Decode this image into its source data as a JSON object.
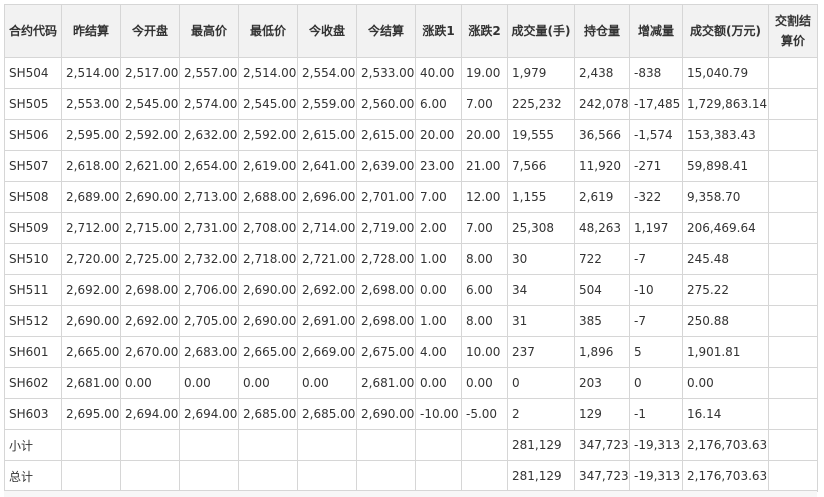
{
  "table": {
    "headers": [
      "合约代码",
      "昨结算",
      "今开盘",
      "最高价",
      "最低价",
      "今收盘",
      "今结算",
      "涨跌1",
      "涨跌2",
      "成交量(手)",
      "持仓量",
      "增减量",
      "成交额(万元)",
      "交割结算价"
    ],
    "rows": [
      [
        "SH504",
        "2,514.00",
        "2,517.00",
        "2,557.00",
        "2,514.00",
        "2,554.00",
        "2,533.00",
        "40.00",
        "19.00",
        "1,979",
        "2,438",
        "-838",
        "15,040.79",
        ""
      ],
      [
        "SH505",
        "2,553.00",
        "2,545.00",
        "2,574.00",
        "2,545.00",
        "2,559.00",
        "2,560.00",
        "6.00",
        "7.00",
        "225,232",
        "242,078",
        "-17,485",
        "1,729,863.14",
        ""
      ],
      [
        "SH506",
        "2,595.00",
        "2,592.00",
        "2,632.00",
        "2,592.00",
        "2,615.00",
        "2,615.00",
        "20.00",
        "20.00",
        "19,555",
        "36,566",
        "-1,574",
        "153,383.43",
        ""
      ],
      [
        "SH507",
        "2,618.00",
        "2,621.00",
        "2,654.00",
        "2,619.00",
        "2,641.00",
        "2,639.00",
        "23.00",
        "21.00",
        "7,566",
        "11,920",
        "-271",
        "59,898.41",
        ""
      ],
      [
        "SH508",
        "2,689.00",
        "2,690.00",
        "2,713.00",
        "2,688.00",
        "2,696.00",
        "2,701.00",
        "7.00",
        "12.00",
        "1,155",
        "2,619",
        "-322",
        "9,358.70",
        ""
      ],
      [
        "SH509",
        "2,712.00",
        "2,715.00",
        "2,731.00",
        "2,708.00",
        "2,714.00",
        "2,719.00",
        "2.00",
        "7.00",
        "25,308",
        "48,263",
        "1,197",
        "206,469.64",
        ""
      ],
      [
        "SH510",
        "2,720.00",
        "2,725.00",
        "2,732.00",
        "2,718.00",
        "2,721.00",
        "2,728.00",
        "1.00",
        "8.00",
        "30",
        "722",
        "-7",
        "245.48",
        ""
      ],
      [
        "SH511",
        "2,692.00",
        "2,698.00",
        "2,706.00",
        "2,690.00",
        "2,692.00",
        "2,698.00",
        "0.00",
        "6.00",
        "34",
        "504",
        "-10",
        "275.22",
        ""
      ],
      [
        "SH512",
        "2,690.00",
        "2,692.00",
        "2,705.00",
        "2,690.00",
        "2,691.00",
        "2,698.00",
        "1.00",
        "8.00",
        "31",
        "385",
        "-7",
        "250.88",
        ""
      ],
      [
        "SH601",
        "2,665.00",
        "2,670.00",
        "2,683.00",
        "2,665.00",
        "2,669.00",
        "2,675.00",
        "4.00",
        "10.00",
        "237",
        "1,896",
        "5",
        "1,901.81",
        ""
      ],
      [
        "SH602",
        "2,681.00",
        "0.00",
        "0.00",
        "0.00",
        "0.00",
        "2,681.00",
        "0.00",
        "0.00",
        "0",
        "203",
        "0",
        "0.00",
        ""
      ],
      [
        "SH603",
        "2,695.00",
        "2,694.00",
        "2,694.00",
        "2,685.00",
        "2,685.00",
        "2,690.00",
        "-10.00",
        "-5.00",
        "2",
        "129",
        "-1",
        "16.14",
        ""
      ],
      [
        "小计",
        "",
        "",
        "",
        "",
        "",
        "",
        "",
        "",
        "281,129",
        "347,723",
        "-19,313",
        "2,176,703.63",
        ""
      ],
      [
        "总计",
        "",
        "",
        "",
        "",
        "",
        "",
        "",
        "",
        "281,129",
        "347,723",
        "-19,313",
        "2,176,703.63",
        ""
      ]
    ]
  }
}
